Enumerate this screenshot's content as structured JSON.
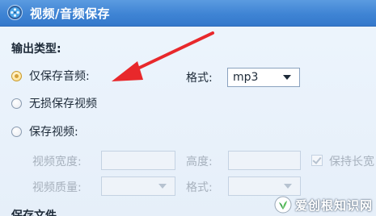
{
  "window": {
    "title": "视频/音频保存",
    "app_icon": "film-reel-icon"
  },
  "output_type": {
    "section_title": "输出类型:",
    "options": [
      {
        "label": "仅保存音频:",
        "checked": true
      },
      {
        "label": "无损保存视频",
        "checked": false
      },
      {
        "label": "保存视频:",
        "checked": false
      }
    ]
  },
  "audio_format": {
    "label": "格式:",
    "value": "mp3"
  },
  "video_settings": {
    "width_label": "视频宽度:",
    "height_label": "高度:",
    "keep_ratio_label": "保持长宽",
    "quality_label": "视频质量:",
    "format_label": "格式:"
  },
  "next_section_title": "保存文件",
  "watermark": {
    "text": "爱创根知识网",
    "icon": "plant-logo-icon"
  },
  "colors": {
    "titlebar": "#3f84d4",
    "annotation_arrow": "#e8282b",
    "radio_selected": "#d6a23a"
  }
}
